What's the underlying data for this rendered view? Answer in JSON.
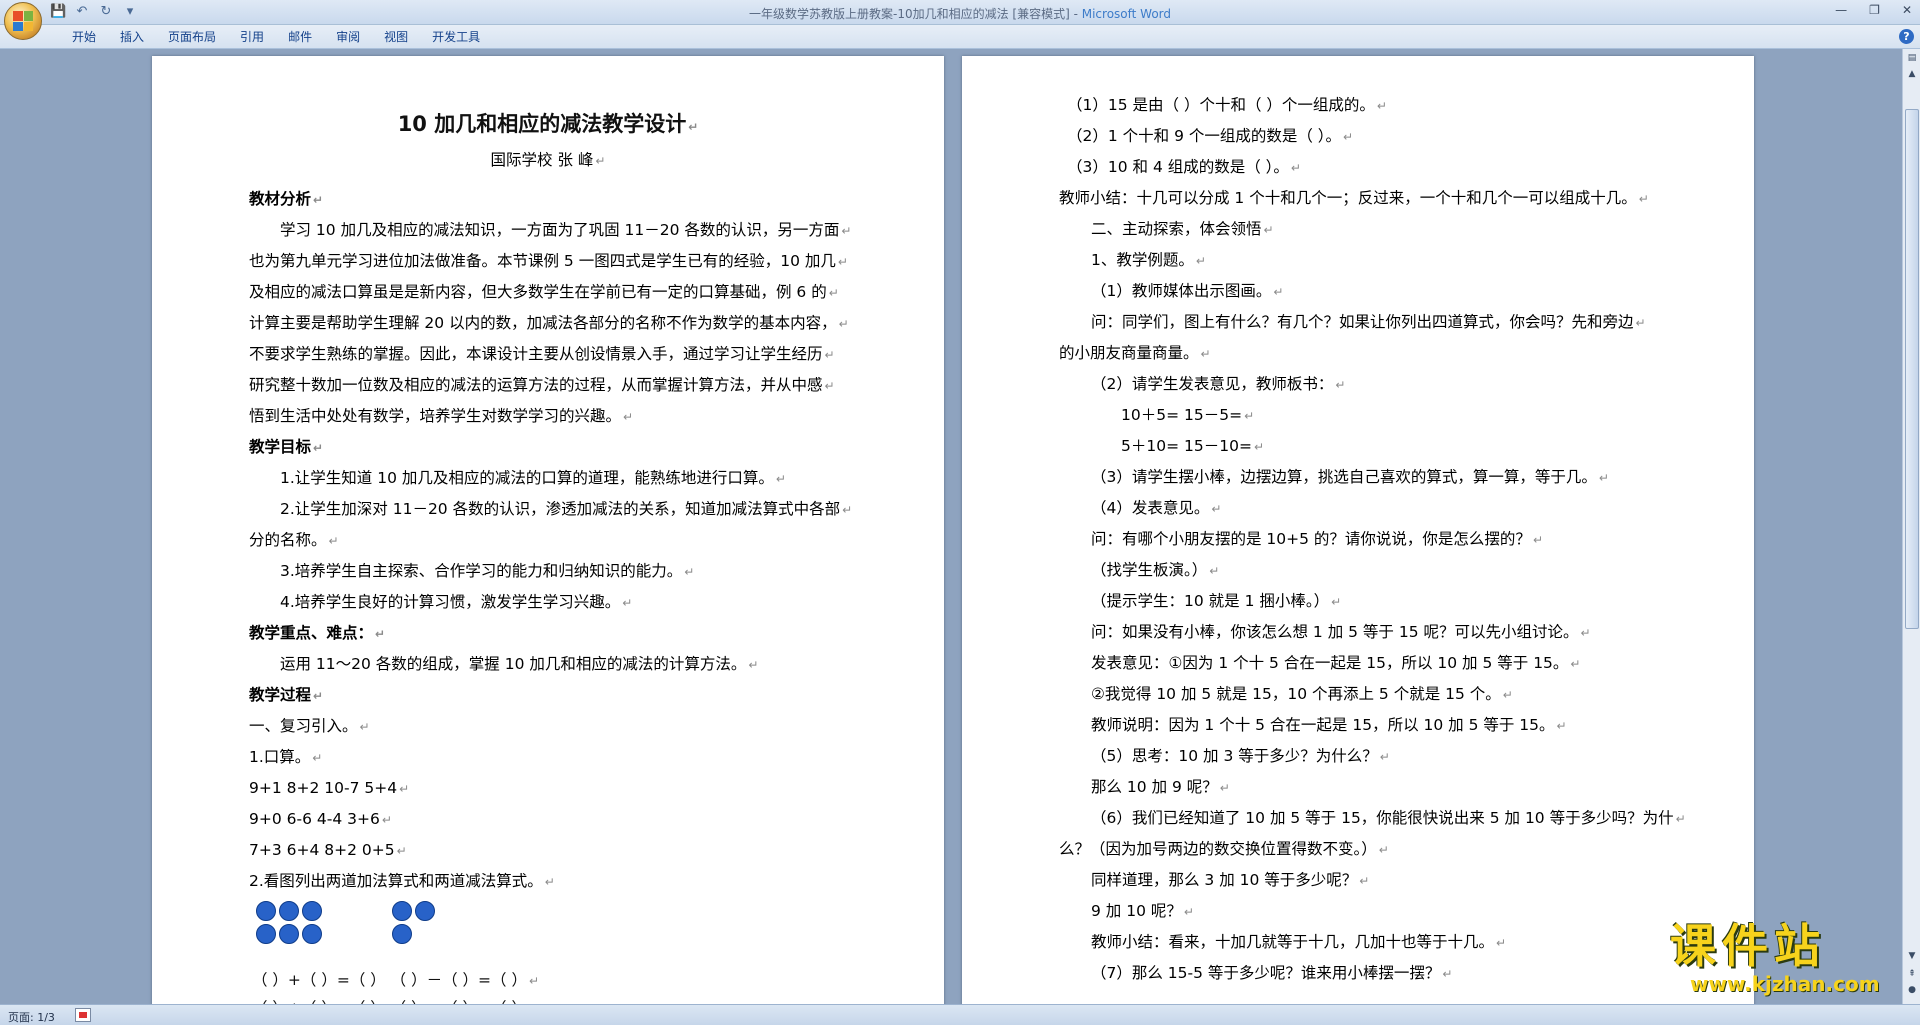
{
  "window": {
    "title_doc": "一年级数学苏教版上册教案-10加几和相应的减法 [兼容模式] - ",
    "title_app": "Microsoft Word"
  },
  "menu": [
    "开始",
    "插入",
    "页面布局",
    "引用",
    "邮件",
    "审阅",
    "视图",
    "开发工具"
  ],
  "left_page": {
    "title": "10 加几和相应的减法教学设计",
    "author": "国际学校   张  峰",
    "lines": [
      {
        "text": "教材分析",
        "bold": true,
        "indent": false
      },
      {
        "text": "学习 10 加几及相应的减法知识，一方面为了巩固 11－20 各数的认识，另一方面",
        "bold": false,
        "indent": true
      },
      {
        "text": "也为第九单元学习进位加法做准备。本节课例 5 一图四式是学生已有的经验，10 加几",
        "bold": false,
        "indent": false
      },
      {
        "text": "及相应的减法口算虽是是新内容，但大多数学生在学前已有一定的口算基础，例 6 的",
        "bold": false,
        "indent": false
      },
      {
        "text": "计算主要是帮助学生理解 20 以内的数，加减法各部分的名称不作为数学的基本内容，",
        "bold": false,
        "indent": false
      },
      {
        "text": "不要求学生熟练的掌握。因此，本课设计主要从创设情景入手，通过学习让学生经历",
        "bold": false,
        "indent": false
      },
      {
        "text": "研究整十数加一位数及相应的减法的运算方法的过程，从而掌握计算方法，并从中感",
        "bold": false,
        "indent": false
      },
      {
        "text": "悟到生活中处处有数学，培养学生对数学学习的兴趣。",
        "bold": false,
        "indent": false
      },
      {
        "text": "教学目标",
        "bold": true,
        "indent": false
      },
      {
        "text": "1.让学生知道 10 加几及相应的减法的口算的道理，能熟练地进行口算。",
        "bold": false,
        "indent": true
      },
      {
        "text": "2.让学生加深对 11－20 各数的认识，渗透加减法的关系，知道加减法算式中各部",
        "bold": false,
        "indent": true
      },
      {
        "text": "分的名称。",
        "bold": false,
        "indent": false
      },
      {
        "text": "3.培养学生自主探索、合作学习的能力和归纳知识的能力。",
        "bold": false,
        "indent": true
      },
      {
        "text": "4.培养学生良好的计算习惯，激发学生学习兴趣。",
        "bold": false,
        "indent": true
      },
      {
        "text": "教学重点、难点：",
        "bold": true,
        "indent": false
      },
      {
        "text": "运用 11～20 各数的组成，掌握 10 加几和相应的减法的计算方法。",
        "bold": false,
        "indent": true
      },
      {
        "text": "教学过程",
        "bold": true,
        "indent": false
      },
      {
        "text": "一、复习引入。",
        "bold": false,
        "indent": false
      },
      {
        "text": "1.口算。",
        "bold": false,
        "indent": false
      },
      {
        "text": "9+1      8+2      10-7      5+4",
        "bold": false,
        "indent": false
      },
      {
        "text": "9+0      6-6       4-4       3+6",
        "bold": false,
        "indent": false
      },
      {
        "text": "7+3      6+4       8+2      0+5",
        "bold": false,
        "indent": false
      },
      {
        "text": "2.看图列出两道加法算式和两道减法算式。",
        "bold": false,
        "indent": false
      }
    ],
    "exercise_lines": [
      "（  ）+（  ）=（  ）      （  ）－（  ）=（  ）",
      "（  ）+（  ）=（  ）      （  ）－（  ）=（  ）"
    ]
  },
  "right_page": {
    "lines": [
      {
        "text": "（1）15 是由（   ）个十和（   ）个一组成的。",
        "indent": 1
      },
      {
        "text": "（2）1 个十和 9 个一组成的数是（   ）。",
        "indent": 1
      },
      {
        "text": "（3）10 和 4 组成的数是（   ）。",
        "indent": 1
      },
      {
        "text": "教师小结：十几可以分成 1 个十和几个一；反过来，一个十和几个一可以组成十几。",
        "indent": 0
      },
      {
        "text": "二、主动探索，体会领悟",
        "indent": 2
      },
      {
        "text": "1、教学例题。",
        "indent": 2
      },
      {
        "text": "（1）教师媒体出示图画。",
        "indent": 2
      },
      {
        "text": "问：同学们，图上有什么？有几个？如果让你列出四道算式，你会吗？先和旁边",
        "indent": 2
      },
      {
        "text": "的小朋友商量商量。",
        "indent": 0
      },
      {
        "text": "（2）请学生发表意见，教师板书：",
        "indent": 2
      },
      {
        "text": "10＋5=                15－5=",
        "indent": 4
      },
      {
        "text": "5＋10=                15－10=",
        "indent": 4
      },
      {
        "text": "（3）请学生摆小棒，边摆边算，挑选自己喜欢的算式，算一算，等于几。",
        "indent": 2
      },
      {
        "text": "（4）发表意见。",
        "indent": 2
      },
      {
        "text": "问：有哪个小朋友摆的是 10+5 的？请你说说，你是怎么摆的？",
        "indent": 2
      },
      {
        "text": "（找学生板演。）",
        "indent": 2
      },
      {
        "text": "（提示学生：10 就是 1 捆小棒。）",
        "indent": 2
      },
      {
        "text": "问：如果没有小棒，你该怎么想 1 加 5 等于 15 呢？可以先小组讨论。",
        "indent": 2
      },
      {
        "text": "发表意见：①因为 1 个十 5 合在一起是 15，所以 10 加 5 等于 15。",
        "indent": 2
      },
      {
        "text": "②我觉得 10 加 5 就是 15，10 个再添上 5 个就是 15 个。",
        "indent": 2
      },
      {
        "text": "教师说明：因为 1 个十 5 合在一起是 15，所以 10 加 5 等于 15。",
        "indent": 2
      },
      {
        "text": "（5）思考：10 加 3 等于多少？为什么？",
        "indent": 2
      },
      {
        "text": "那么 10 加 9 呢？",
        "indent": 2
      },
      {
        "text": "（6）我们已经知道了 10 加 5 等于 15，你能很快说出来 5 加 10 等于多少吗？为什",
        "indent": 2
      },
      {
        "text": "么？（因为加号两边的数交换位置得数不变。）",
        "indent": 0
      },
      {
        "text": "同样道理，那么 3 加 10 等于多少呢？",
        "indent": 2
      },
      {
        "text": "9 加 10 呢？",
        "indent": 2
      },
      {
        "text": "教师小结：看来，十加几就等于十几，几加十也等于十几。",
        "indent": 2
      },
      {
        "text": "（7）那么 15-5 等于多少呢？谁来用小棒摆一摆？",
        "indent": 2
      }
    ]
  },
  "status": {
    "page": "页面: 1/3"
  },
  "watermark": {
    "main": "课件站",
    "sub": "www.kjzhan.com"
  },
  "colors": {
    "workspace": "#8ea3bf",
    "dots": "#2862c8",
    "watermark": "#f7d31c"
  }
}
